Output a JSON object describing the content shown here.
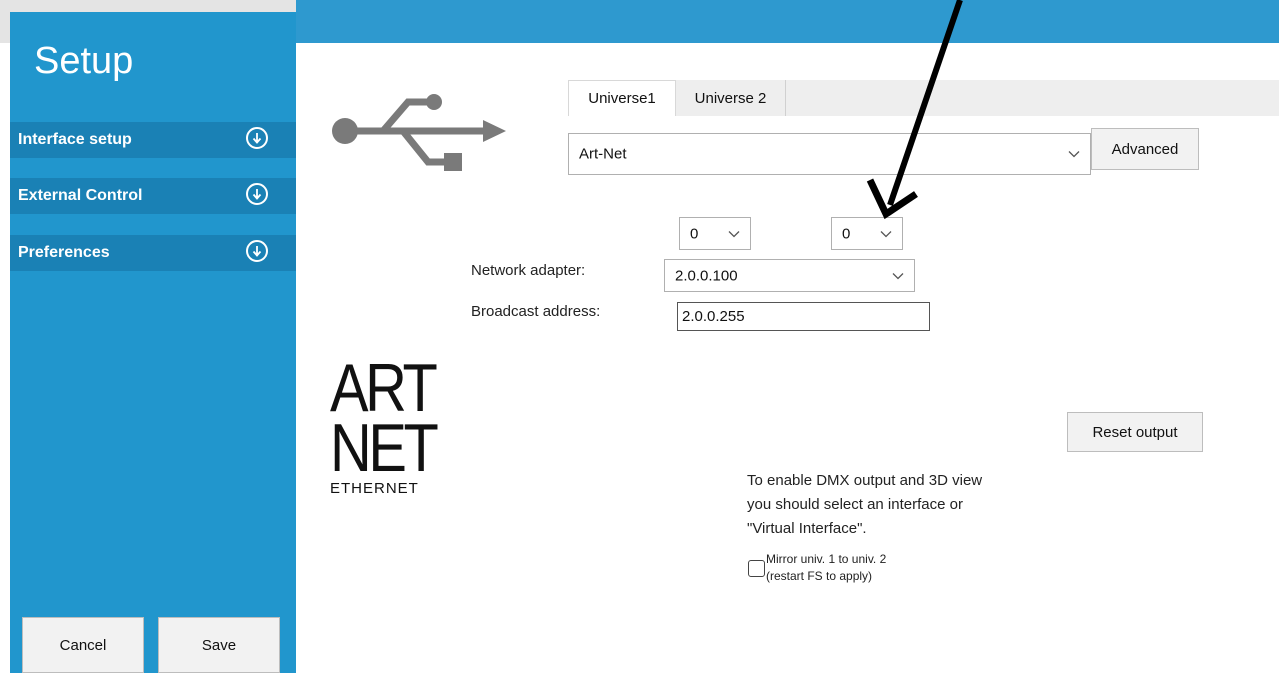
{
  "sidebar": {
    "title": "Setup",
    "items": [
      {
        "label": "Interface setup"
      },
      {
        "label": "External Control"
      },
      {
        "label": "Preferences"
      }
    ],
    "cancel_label": "Cancel",
    "save_label": "Save"
  },
  "tabs": [
    {
      "label": "Universe1",
      "active": true
    },
    {
      "label": "Universe 2",
      "active": false
    }
  ],
  "interface": {
    "selected": "Art-Net",
    "advanced_label": "Advanced",
    "subnet_value": "0",
    "universe_value": "0"
  },
  "network": {
    "adapter_label": "Network adapter:",
    "adapter_value": "2.0.0.100",
    "broadcast_label": "Broadcast address:",
    "broadcast_value": "2.0.0.255"
  },
  "logo": {
    "line1": "ART",
    "line2": "NET",
    "line3": "ETHERNET"
  },
  "reset_label": "Reset output",
  "message": {
    "line1": "To enable DMX output and 3D view",
    "line2": "you should select an interface or",
    "line3": "\"Virtual Interface\"."
  },
  "mirror": {
    "line1": "Mirror univ. 1 to univ. 2",
    "line2": "(restart FS to apply)",
    "checked": false
  },
  "icons": [
    "usb-icon",
    "chevron-down-icon",
    "arrow-down-circle-icon",
    "annotation-arrow-icon"
  ],
  "colors": {
    "accent": "#2196cd",
    "sidebar_item": "#1a81b5"
  }
}
